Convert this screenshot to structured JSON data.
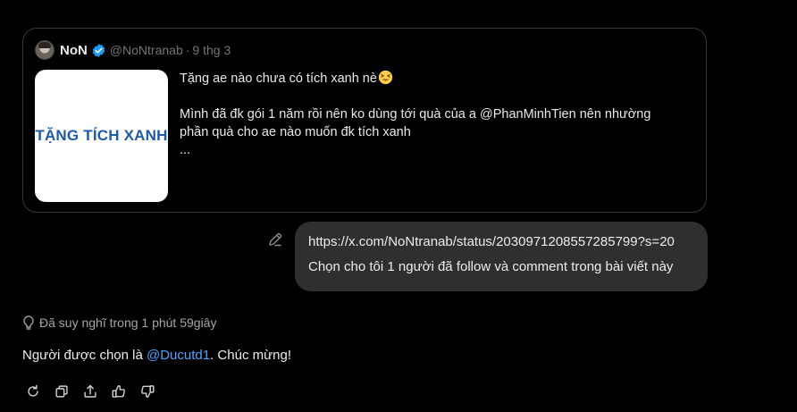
{
  "quote_card": {
    "author": {
      "display_name": "NoN",
      "verified": true,
      "handle": "@NoNtranab",
      "separator": "·",
      "date": "9 thg 3"
    },
    "thumbnail": {
      "text": "TẶNG TÍCH XANH",
      "text_color": "#1f5aa8",
      "background": "#ffffff"
    },
    "text": {
      "line1": "Tặng ae nào chưa có tích xanh nè",
      "line1_emoji": "squinting-face-with-tongue",
      "paragraph2_prefix": "Mình đã đk gói 1 năm rồi nên ko dùng tới quà của a ",
      "paragraph2_mention": "@PhanMinhTien",
      "paragraph2_suffix": " nên nhường",
      "paragraph2_line2": "phần quà cho ae nào muốn đk tích xanh",
      "ellipsis": "..."
    }
  },
  "user_message": {
    "edit_icon": "pencil-icon",
    "line1": "https://x.com/NoNtranab/status/2030971208557285799?s=20",
    "line2": "Chọn cho tôi 1 người đã follow và comment trong bài viết này"
  },
  "thinking": {
    "icon": "lightbulb-icon",
    "label": "Đã suy nghĩ trong 1 phút 59giây"
  },
  "answer": {
    "prefix": "Người được chọn là ",
    "mention": "@Ducutd1",
    "suffix": ". Chúc mừng!"
  },
  "action_bar": {
    "icons": [
      "regenerate-icon",
      "copy-icon",
      "share-icon",
      "thumbs-up-icon",
      "thumbs-down-icon"
    ]
  },
  "colors": {
    "background": "#000000",
    "bubble": "#2f2f2f",
    "link": "#4da3ff",
    "verified": "#1d9bf0",
    "muted": "#71767b"
  }
}
